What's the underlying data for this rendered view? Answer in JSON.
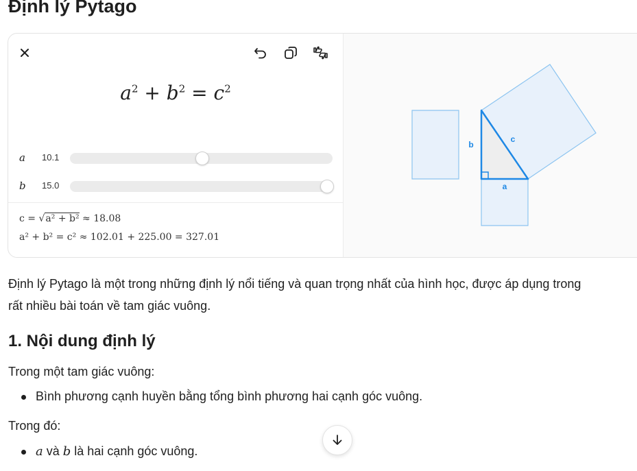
{
  "title": "Định lý Pytago",
  "widget": {
    "formula": {
      "a": "a",
      "b": "b",
      "c": "c",
      "exp": "2",
      "plus": "+",
      "eq": "="
    },
    "sliders": [
      {
        "var": "a",
        "value": "10.1",
        "fraction": 0.5
      },
      {
        "var": "b",
        "value": "15.0",
        "fraction": 1.0
      }
    ],
    "calc_line1": {
      "lhs": "c = ",
      "radicand": "a² + b²",
      "approx": " ≈ 18.08"
    },
    "calc_line2": {
      "text": "a² + b² = c² ≈ 102.01 + 225.00 = 327.01"
    },
    "diagram": {
      "label_a": "a",
      "label_b": "b",
      "label_c": "c",
      "stroke_color": "#1e88e5",
      "fill_color": "#e8f1fb"
    },
    "icons": [
      "close-icon",
      "undo-icon",
      "copy-icon",
      "feedback-icon"
    ]
  },
  "intro": {
    "line1": "Định lý Pytago là một trong những định lý nổi tiếng và quan trọng nhất của hình học, được áp dụng trong",
    "line2": "rất nhiều bài toán về tam giác vuông."
  },
  "section1": {
    "heading": "1. Nội dung định lý",
    "lead": "Trong một tam giác vuông:",
    "bullet1": "Bình phương cạnh huyền bằng tổng bình phương hai cạnh góc vuông.",
    "where": "Trong đó:",
    "bullet2_var_a": "a",
    "bullet2_and": " và ",
    "bullet2_var_b": "b",
    "bullet2_rest": " là hai cạnh góc vuông."
  }
}
